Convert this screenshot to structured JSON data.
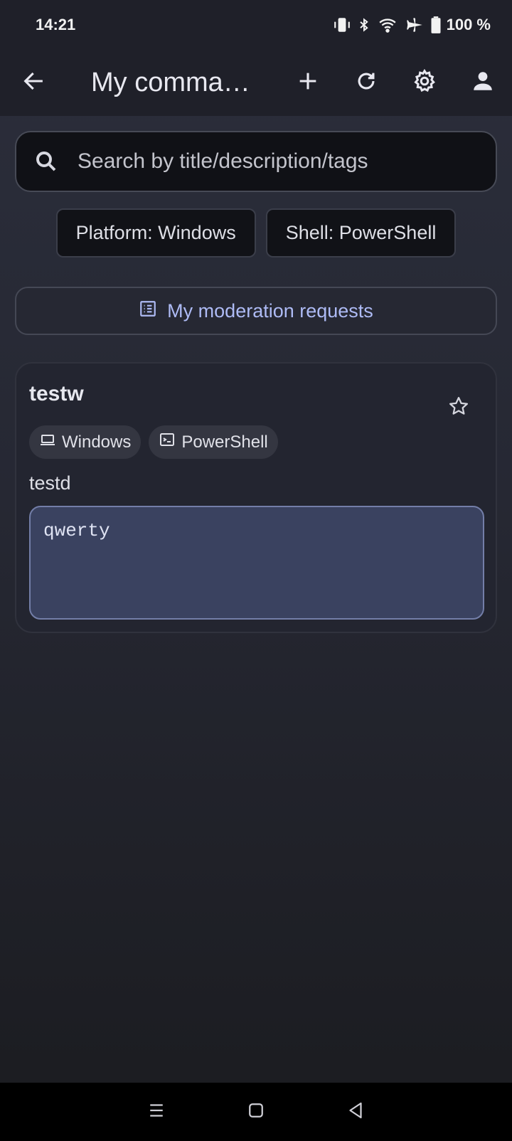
{
  "status": {
    "time": "14:21",
    "battery": "100 %"
  },
  "appbar": {
    "title": "My comma…"
  },
  "search": {
    "placeholder": "Search by title/description/tags"
  },
  "filters": [
    {
      "label": "Platform: Windows"
    },
    {
      "label": "Shell: PowerShell"
    }
  ],
  "moderation": {
    "label": "My moderation requests"
  },
  "card": {
    "title": "testw",
    "tags": [
      {
        "label": "Windows",
        "icon": "laptop-icon"
      },
      {
        "label": "PowerShell",
        "icon": "terminal-icon"
      }
    ],
    "description": "testd",
    "command": "qwerty"
  },
  "colors": {
    "accent": "#aebbf5",
    "background": "#262833",
    "code_bg": "#3a4260"
  }
}
